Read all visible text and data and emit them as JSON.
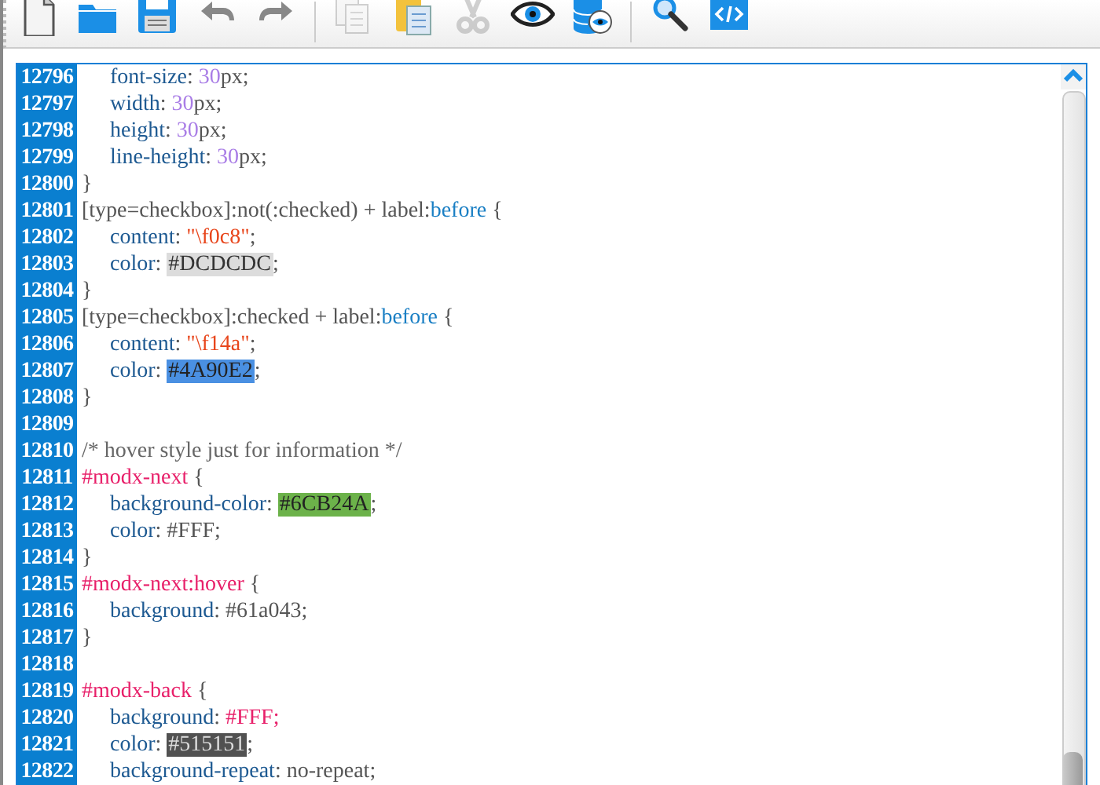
{
  "toolbar": [
    {
      "kind": "new",
      "disabled": false
    },
    {
      "kind": "open",
      "disabled": false
    },
    {
      "kind": "save",
      "disabled": false
    },
    {
      "kind": "undo",
      "disabled": false
    },
    {
      "kind": "redo",
      "disabled": false
    },
    {
      "kind": "separator"
    },
    {
      "kind": "copy",
      "disabled": true
    },
    {
      "kind": "paste",
      "disabled": false
    },
    {
      "kind": "cut",
      "disabled": true
    },
    {
      "kind": "preview",
      "disabled": false
    },
    {
      "kind": "db-preview",
      "disabled": false
    },
    {
      "kind": "separator"
    },
    {
      "kind": "search",
      "disabled": false
    },
    {
      "kind": "code",
      "disabled": false
    }
  ],
  "editor": {
    "lines": [
      {
        "number": "12796",
        "indent": true,
        "tokens": [
          {
            "kind": "prop",
            "text": "font-size"
          },
          {
            "kind": "text",
            "text": ": "
          },
          {
            "kind": "num",
            "text": "30"
          },
          {
            "kind": "text",
            "text": "px;"
          }
        ]
      },
      {
        "number": "12797",
        "indent": true,
        "tokens": [
          {
            "kind": "prop",
            "text": "width"
          },
          {
            "kind": "text",
            "text": ": "
          },
          {
            "kind": "num",
            "text": "30"
          },
          {
            "kind": "text",
            "text": "px;"
          }
        ]
      },
      {
        "number": "12798",
        "indent": true,
        "tokens": [
          {
            "kind": "prop",
            "text": "height"
          },
          {
            "kind": "text",
            "text": ": "
          },
          {
            "kind": "num",
            "text": "30"
          },
          {
            "kind": "text",
            "text": "px;"
          }
        ]
      },
      {
        "number": "12799",
        "indent": true,
        "tokens": [
          {
            "kind": "prop",
            "text": "line-height"
          },
          {
            "kind": "text",
            "text": ": "
          },
          {
            "kind": "num",
            "text": "30"
          },
          {
            "kind": "text",
            "text": "px;"
          }
        ]
      },
      {
        "number": "12800",
        "indent": false,
        "tokens": [
          {
            "kind": "text",
            "text": "}"
          }
        ]
      },
      {
        "number": "12801",
        "indent": false,
        "tokens": [
          {
            "kind": "text",
            "text": "[type=checkbox]:not(:checked) + label:"
          },
          {
            "kind": "pseudo",
            "text": "before"
          },
          {
            "kind": "text",
            "text": " {"
          }
        ]
      },
      {
        "number": "12802",
        "indent": true,
        "tokens": [
          {
            "kind": "prop",
            "text": "content"
          },
          {
            "kind": "text",
            "text": ": "
          },
          {
            "kind": "str",
            "text": "\"\\f0c8\""
          },
          {
            "kind": "text",
            "text": ";"
          }
        ]
      },
      {
        "number": "12803",
        "indent": true,
        "tokens": [
          {
            "kind": "prop",
            "text": "color"
          },
          {
            "kind": "text",
            "text": ": "
          },
          {
            "kind": "swatch",
            "text": "#DCDCDC",
            "color": "#dcdcdc"
          },
          {
            "kind": "text",
            "text": ";"
          }
        ]
      },
      {
        "number": "12804",
        "indent": false,
        "tokens": [
          {
            "kind": "text",
            "text": "}"
          }
        ]
      },
      {
        "number": "12805",
        "indent": false,
        "tokens": [
          {
            "kind": "text",
            "text": "[type=checkbox]:checked + label:"
          },
          {
            "kind": "pseudo",
            "text": "before"
          },
          {
            "kind": "text",
            "text": " {"
          }
        ]
      },
      {
        "number": "12806",
        "indent": true,
        "tokens": [
          {
            "kind": "prop",
            "text": "content"
          },
          {
            "kind": "text",
            "text": ": "
          },
          {
            "kind": "str",
            "text": "\"\\f14a\""
          },
          {
            "kind": "text",
            "text": ";"
          }
        ]
      },
      {
        "number": "12807",
        "indent": true,
        "tokens": [
          {
            "kind": "prop",
            "text": "color"
          },
          {
            "kind": "text",
            "text": ": "
          },
          {
            "kind": "swatch",
            "text": "#4A90E2",
            "color": "#4a90e2"
          },
          {
            "kind": "text",
            "text": ";"
          }
        ]
      },
      {
        "number": "12808",
        "indent": false,
        "tokens": [
          {
            "kind": "text",
            "text": "}"
          }
        ]
      },
      {
        "number": "12809"
      },
      {
        "number": "12810",
        "indent": false,
        "tokens": [
          {
            "kind": "comment",
            "text": "/* hover style just for information */"
          }
        ]
      },
      {
        "number": "12811",
        "indent": false,
        "tokens": [
          {
            "kind": "id",
            "text": "#modx-next"
          },
          {
            "kind": "text",
            "text": " {"
          }
        ]
      },
      {
        "number": "12812",
        "indent": true,
        "tokens": [
          {
            "kind": "prop",
            "text": "background-color"
          },
          {
            "kind": "text",
            "text": ": "
          },
          {
            "kind": "swatch",
            "text": "#6CB24A",
            "color": "#6cb24a"
          },
          {
            "kind": "text",
            "text": ";"
          }
        ]
      },
      {
        "number": "12813",
        "indent": true,
        "tokens": [
          {
            "kind": "prop",
            "text": "color"
          },
          {
            "kind": "text",
            "text": ": #FFF;"
          }
        ]
      },
      {
        "number": "12814",
        "indent": false,
        "tokens": [
          {
            "kind": "text",
            "text": "}"
          }
        ]
      },
      {
        "number": "12815",
        "indent": false,
        "tokens": [
          {
            "kind": "id",
            "text": "#modx-next:hover"
          },
          {
            "kind": "text",
            "text": " {"
          }
        ]
      },
      {
        "number": "12816",
        "indent": true,
        "tokens": [
          {
            "kind": "prop",
            "text": "background"
          },
          {
            "kind": "text",
            "text": ": #61a043;"
          }
        ]
      },
      {
        "number": "12817",
        "indent": false,
        "tokens": [
          {
            "kind": "text",
            "text": "}"
          }
        ]
      },
      {
        "number": "12818"
      },
      {
        "number": "12819",
        "indent": false,
        "tokens": [
          {
            "kind": "id",
            "text": "#modx-back"
          },
          {
            "kind": "text",
            "text": " {"
          }
        ]
      },
      {
        "number": "12820",
        "indent": true,
        "tokens": [
          {
            "kind": "prop",
            "text": "background"
          },
          {
            "kind": "text",
            "text": ": "
          },
          {
            "kind": "id",
            "text": "#FFF;"
          }
        ]
      },
      {
        "number": "12821",
        "indent": true,
        "tokens": [
          {
            "kind": "prop",
            "text": "color"
          },
          {
            "kind": "text",
            "text": ": "
          },
          {
            "kind": "swatch",
            "text": "#515151",
            "color": "#515151"
          },
          {
            "kind": "text",
            "text": ";"
          }
        ]
      },
      {
        "number": "12822",
        "indent": true,
        "tokens": [
          {
            "kind": "prop",
            "text": "background-repeat"
          },
          {
            "kind": "text",
            "text": ": no-repeat;"
          }
        ]
      }
    ]
  }
}
